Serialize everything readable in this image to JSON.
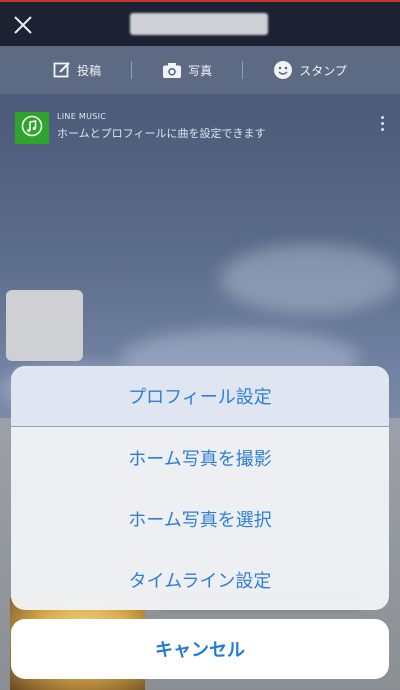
{
  "navbar": {
    "close_icon": "close-icon"
  },
  "toolbar": {
    "post_label": "投稿",
    "photo_label": "写真",
    "stamp_label": "スタンプ"
  },
  "cover": {
    "music_title": "LINE MUSIC",
    "music_desc": "ホームとプロフィールに曲を設定できます"
  },
  "sheet": {
    "items": [
      {
        "label": "プロフィール設定"
      },
      {
        "label": "ホーム写真を撮影"
      },
      {
        "label": "ホーム写真を選択"
      },
      {
        "label": "タイムライン設定"
      }
    ],
    "cancel_label": "キャンセル"
  },
  "colors": {
    "navbar_bg": "#1d2233",
    "toolbar_bg": "#5d6a83",
    "sheet_text": "#2f7fd6",
    "line_green": "#2da52d"
  }
}
